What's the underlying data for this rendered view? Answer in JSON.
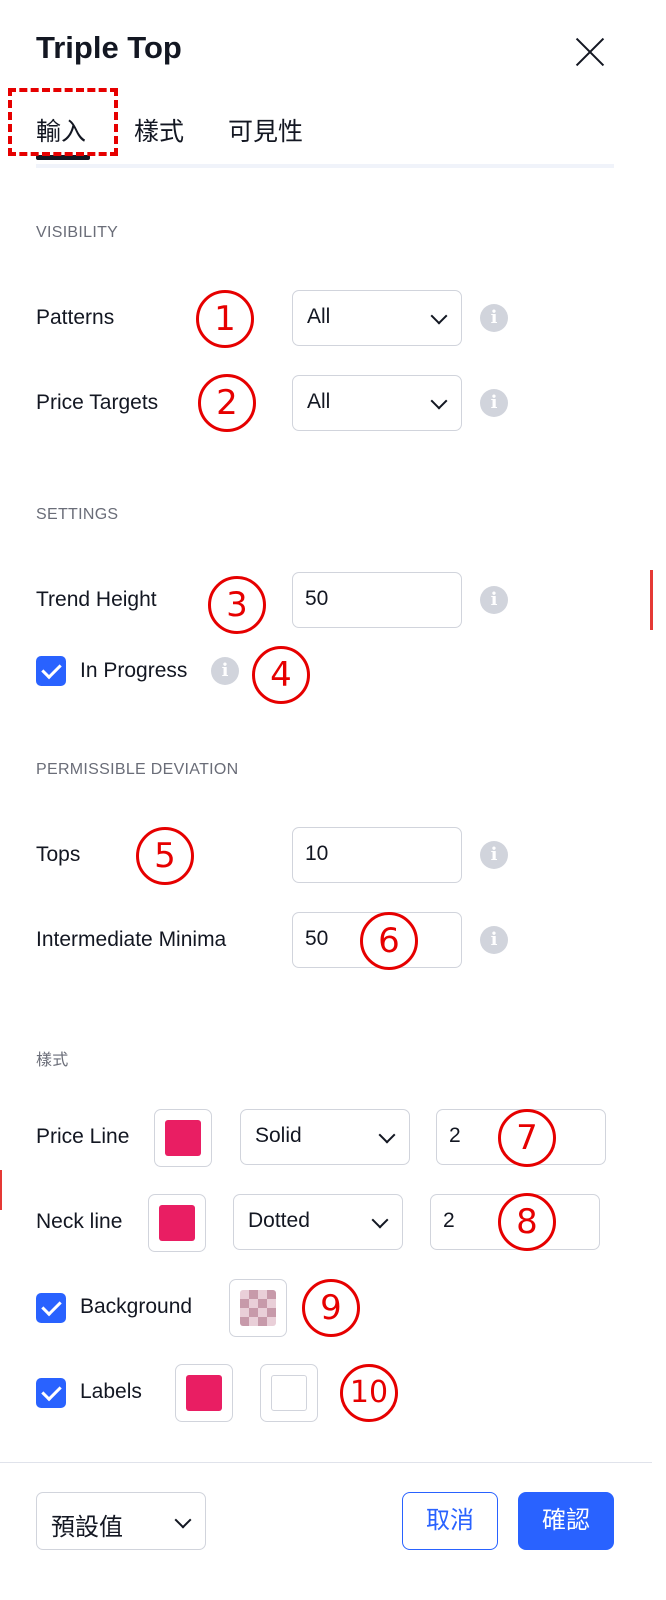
{
  "dialog": {
    "title": "Triple Top"
  },
  "tabs": [
    {
      "label": "輸入"
    },
    {
      "label": "樣式"
    },
    {
      "label": "可見性"
    }
  ],
  "sections": {
    "visibility": "VISIBILITY",
    "settings": "SETTINGS",
    "deviation": "PERMISSIBLE DEVIATION",
    "style": "樣式"
  },
  "fields": {
    "patterns": {
      "label": "Patterns",
      "value": "All"
    },
    "price_targets": {
      "label": "Price Targets",
      "value": "All"
    },
    "trend_height": {
      "label": "Trend Height",
      "value": "50"
    },
    "in_progress": {
      "label": "In Progress",
      "checked": true
    },
    "tops": {
      "label": "Tops",
      "value": "10"
    },
    "intermediate_minima": {
      "label": "Intermediate Minima",
      "value": "50"
    },
    "price_line": {
      "label": "Price Line",
      "color": "#e91e63",
      "style": "Solid",
      "width": "2"
    },
    "neck_line": {
      "label": "Neck line",
      "color": "#e91e63",
      "style": "Dotted",
      "width": "2"
    },
    "background": {
      "label": "Background",
      "checked": true
    },
    "labels": {
      "label": "Labels",
      "checked": true,
      "color": "#e91e63",
      "text_color": "#ffffff"
    }
  },
  "annotations": [
    "1",
    "2",
    "3",
    "4",
    "5",
    "6",
    "7",
    "8",
    "9",
    "10"
  ],
  "footer": {
    "defaults": "預設值",
    "cancel": "取消",
    "ok": "確認"
  },
  "colors": {
    "accent": "#2962ff",
    "annotation": "#e60000",
    "swatch": "#e91e63"
  }
}
